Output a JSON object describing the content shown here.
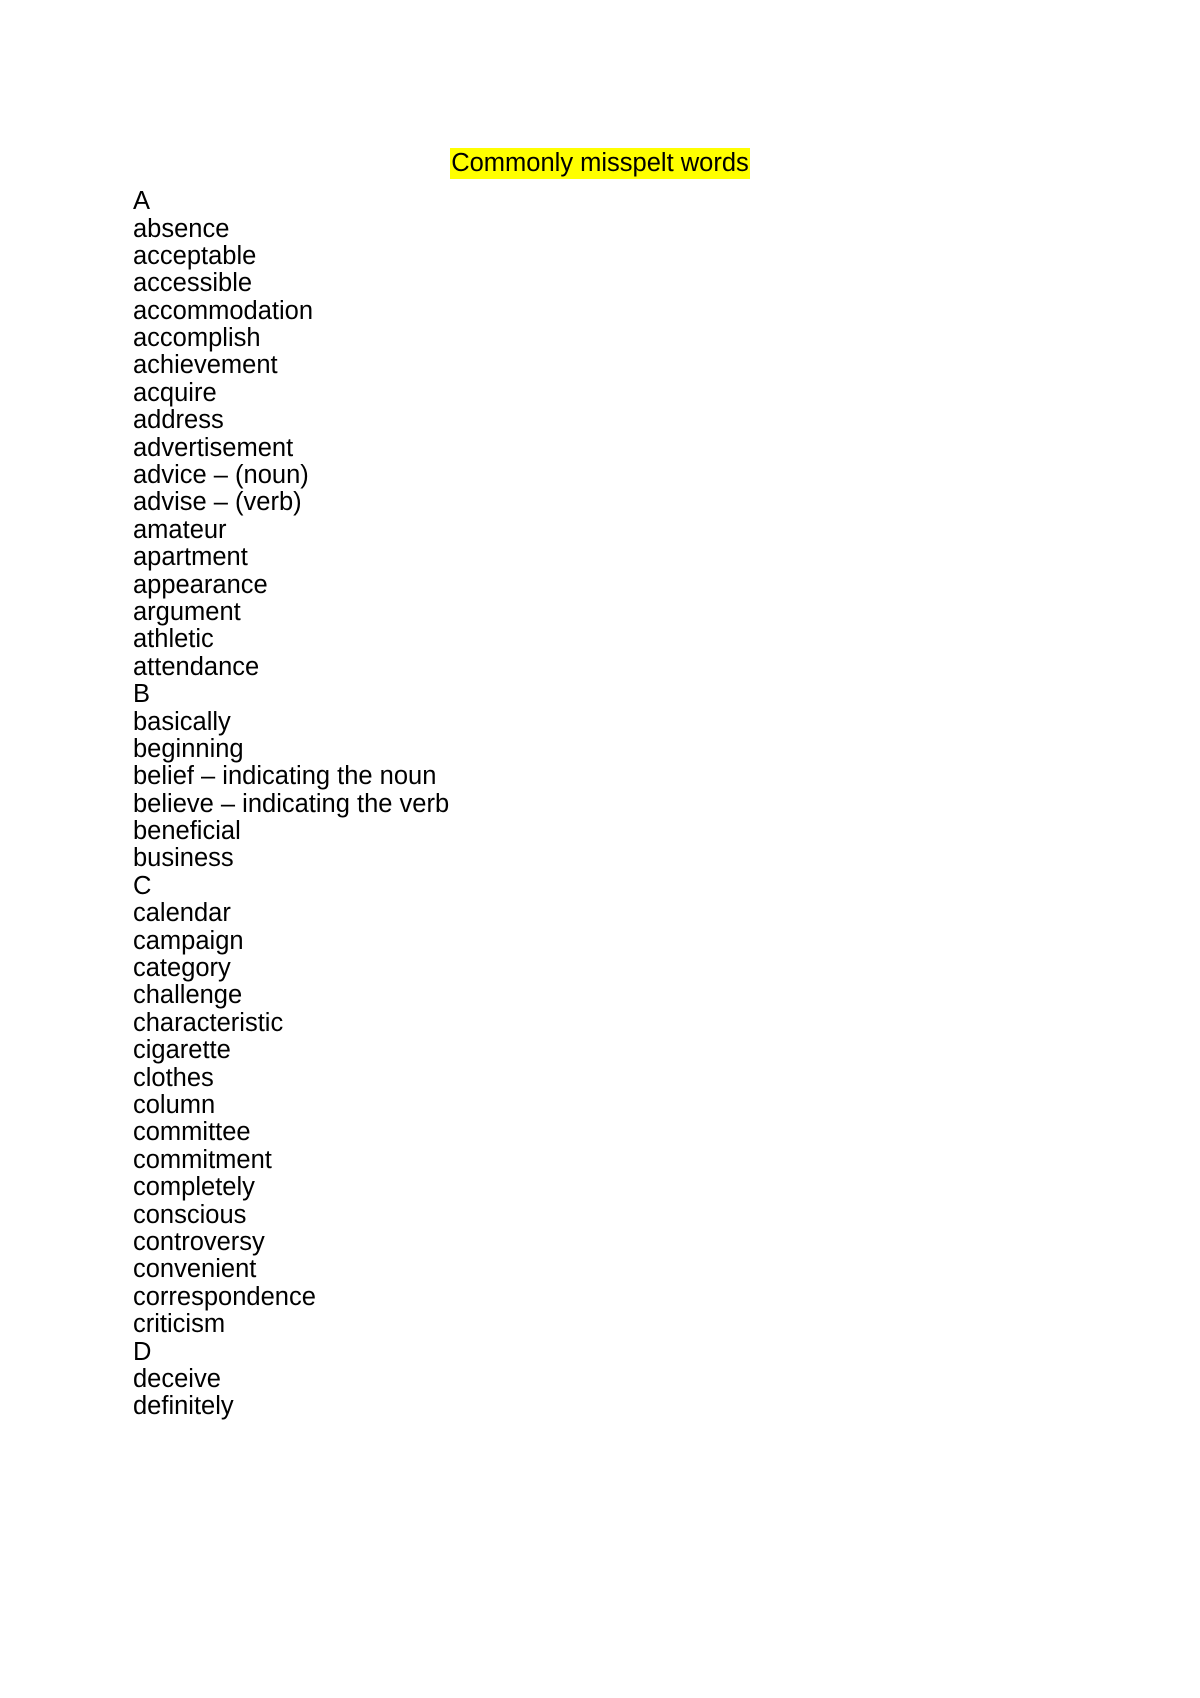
{
  "document": {
    "title": "Commonly misspelt words",
    "title_highlight_color": "#FFFF00",
    "text_color": "#000000",
    "page_background": "#ffffff",
    "lines": [
      {
        "text": "A",
        "type": "section-letter"
      },
      {
        "text": "absence",
        "type": "word"
      },
      {
        "text": "acceptable",
        "type": "word"
      },
      {
        "text": "accessible",
        "type": "word"
      },
      {
        "text": "accommodation",
        "type": "word"
      },
      {
        "text": "accomplish",
        "type": "word"
      },
      {
        "text": "achievement",
        "type": "word"
      },
      {
        "text": "acquire",
        "type": "word"
      },
      {
        "text": "address",
        "type": "word"
      },
      {
        "text": "advertisement",
        "type": "word"
      },
      {
        "text": "advice – (noun)",
        "type": "word"
      },
      {
        "text": "advise – (verb)",
        "type": "word"
      },
      {
        "text": "amateur",
        "type": "word"
      },
      {
        "text": "apartment",
        "type": "word"
      },
      {
        "text": "appearance",
        "type": "word"
      },
      {
        "text": "argument",
        "type": "word"
      },
      {
        "text": "athletic",
        "type": "word"
      },
      {
        "text": "attendance",
        "type": "word"
      },
      {
        "text": "B",
        "type": "section-letter"
      },
      {
        "text": "basically",
        "type": "word"
      },
      {
        "text": "beginning",
        "type": "word"
      },
      {
        "text": "belief – indicating the noun",
        "type": "word"
      },
      {
        "text": "believe – indicating the verb",
        "type": "word"
      },
      {
        "text": "beneficial",
        "type": "word"
      },
      {
        "text": "business",
        "type": "word"
      },
      {
        "text": "C",
        "type": "section-letter"
      },
      {
        "text": "calendar",
        "type": "word"
      },
      {
        "text": "campaign",
        "type": "word"
      },
      {
        "text": "category",
        "type": "word"
      },
      {
        "text": "challenge",
        "type": "word"
      },
      {
        "text": "characteristic",
        "type": "word"
      },
      {
        "text": "cigarette",
        "type": "word"
      },
      {
        "text": "clothes",
        "type": "word"
      },
      {
        "text": "column",
        "type": "word"
      },
      {
        "text": "committee",
        "type": "word"
      },
      {
        "text": "commitment",
        "type": "word"
      },
      {
        "text": "completely",
        "type": "word"
      },
      {
        "text": "conscious",
        "type": "word"
      },
      {
        "text": "controversy",
        "type": "word"
      },
      {
        "text": "convenient",
        "type": "word"
      },
      {
        "text": "correspondence",
        "type": "word"
      },
      {
        "text": "criticism",
        "type": "word"
      },
      {
        "text": "D",
        "type": "section-letter"
      },
      {
        "text": "deceive",
        "type": "word"
      },
      {
        "text": "definitely",
        "type": "word"
      }
    ]
  }
}
